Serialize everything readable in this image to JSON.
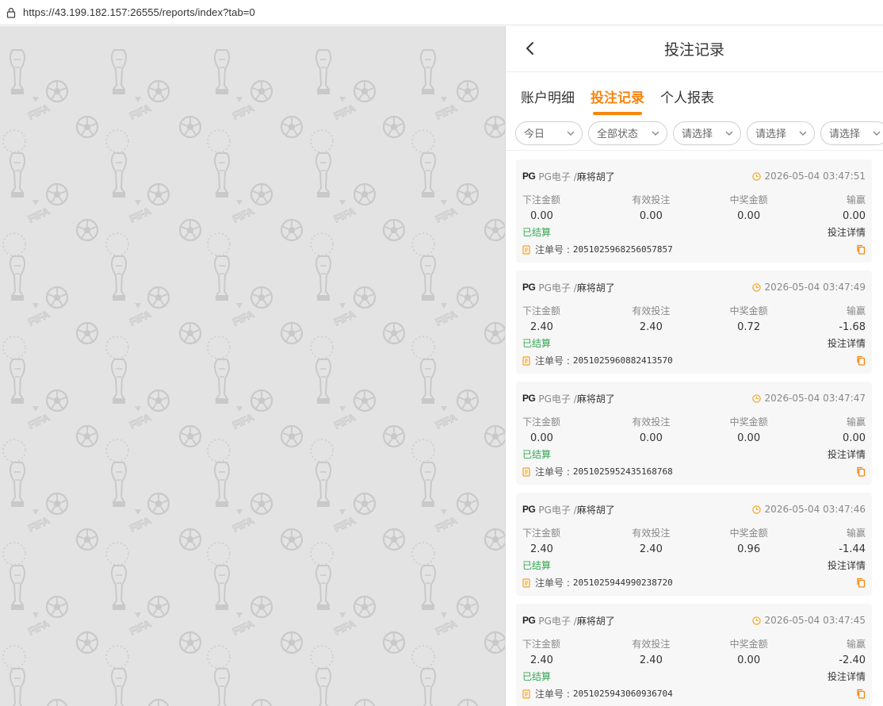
{
  "browser": {
    "url": "https://43.199.182.157:26555/reports/index?tab=0"
  },
  "background": {
    "watermark_text": "FIFA",
    "color": "#e3e3e3"
  },
  "header": {
    "title": "投注记录"
  },
  "tabs": [
    {
      "label": "账户明细",
      "active": false
    },
    {
      "label": "投注记录",
      "active": true
    },
    {
      "label": "个人报表",
      "active": false
    }
  ],
  "filters": [
    "今日",
    "全部状态",
    "请选择",
    "请选择",
    "请选择"
  ],
  "column_labels": {
    "bet": "下注金额",
    "valid": "有效投注",
    "win": "中奖金额",
    "profit": "输赢"
  },
  "labels": {
    "order_prefix": "注单号 :",
    "detail": "投注详情"
  },
  "bets": [
    {
      "brand": "PG",
      "provider": "PG电子 /",
      "game": "麻将胡了",
      "time": "2026-05-04 03:47:51",
      "bet": "0.00",
      "valid": "0.00",
      "win": "0.00",
      "profit": "0.00",
      "status": "已结算",
      "order": "2051025968256057857"
    },
    {
      "brand": "PG",
      "provider": "PG电子 /",
      "game": "麻将胡了",
      "time": "2026-05-04 03:47:49",
      "bet": "2.40",
      "valid": "2.40",
      "win": "0.72",
      "profit": "-1.68",
      "status": "已结算",
      "order": "2051025960882413570"
    },
    {
      "brand": "PG",
      "provider": "PG电子 /",
      "game": "麻将胡了",
      "time": "2026-05-04 03:47:47",
      "bet": "0.00",
      "valid": "0.00",
      "win": "0.00",
      "profit": "0.00",
      "status": "已结算",
      "order": "2051025952435168768"
    },
    {
      "brand": "PG",
      "provider": "PG电子 /",
      "game": "麻将胡了",
      "time": "2026-05-04 03:47:46",
      "bet": "2.40",
      "valid": "2.40",
      "win": "0.96",
      "profit": "-1.44",
      "status": "已结算",
      "order": "2051025944990238720"
    },
    {
      "brand": "PG",
      "provider": "PG电子 /",
      "game": "麻将胡了",
      "time": "2026-05-04 03:47:45",
      "bet": "2.40",
      "valid": "2.40",
      "win": "0.00",
      "profit": "-2.40",
      "status": "已结算",
      "order": "2051025943060936704"
    }
  ],
  "colors": {
    "accent": "#f7850c",
    "loss": "#e33b3b",
    "settled": "#34a853"
  }
}
